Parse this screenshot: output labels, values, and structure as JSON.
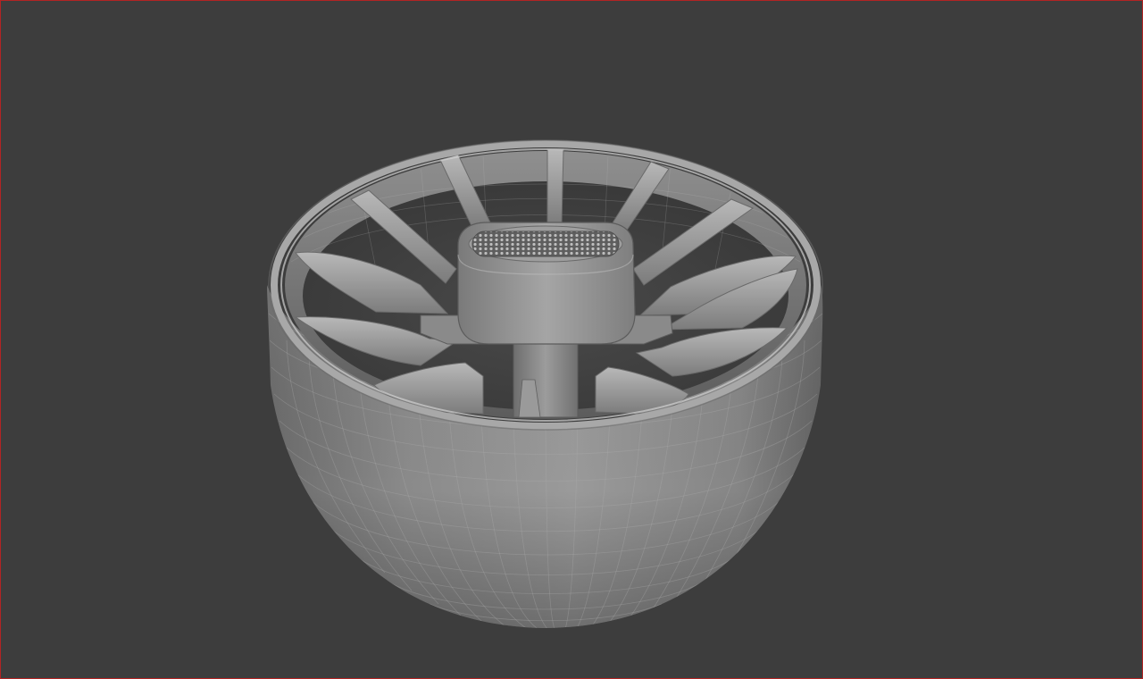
{
  "viewport": {
    "background_color": "#3d3d3d",
    "active_border_color": "#b32424",
    "shading": "solid",
    "wireframe_overlay": true
  },
  "model": {
    "object": "bowl-with-radial-vanes",
    "base_color": "#8e8e8e",
    "highlight_color": "#c8c8c8",
    "shadow_color": "#5a5a5a",
    "vane_count": 12,
    "has_center_hub": true,
    "has_mesh_grille": true
  }
}
